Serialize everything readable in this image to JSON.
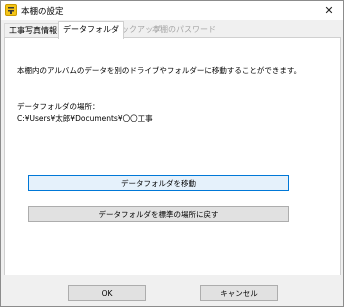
{
  "window": {
    "title": "本棚の設定",
    "close_glyph": "✕"
  },
  "tabs": [
    {
      "label": "工事写真情報",
      "state": "normal"
    },
    {
      "label": "データフォルダ",
      "state": "active"
    },
    {
      "label": "バックアップ",
      "state": "disabled"
    },
    {
      "label": "本棚のパスワード",
      "state": "disabled"
    }
  ],
  "panel": {
    "description": "本棚内のアルバムのデータを別のドライブやフォルダーに移動することができます。",
    "location_label": "データフォルダの場所：",
    "location_path": "C:¥Users¥太郎¥Documents¥〇〇工事",
    "move_button": "データフォルダを移動",
    "reset_button": "データフォルダを標準の場所に戻す"
  },
  "footer": {
    "ok": "OK",
    "cancel": "キャンセル"
  },
  "colors": {
    "primary_button_bg": "#e5f1fb",
    "primary_button_border": "#0078d7",
    "icon_yellow": "#f5c518"
  },
  "icons": {
    "app": "shelf-app-icon",
    "close": "close-icon"
  }
}
